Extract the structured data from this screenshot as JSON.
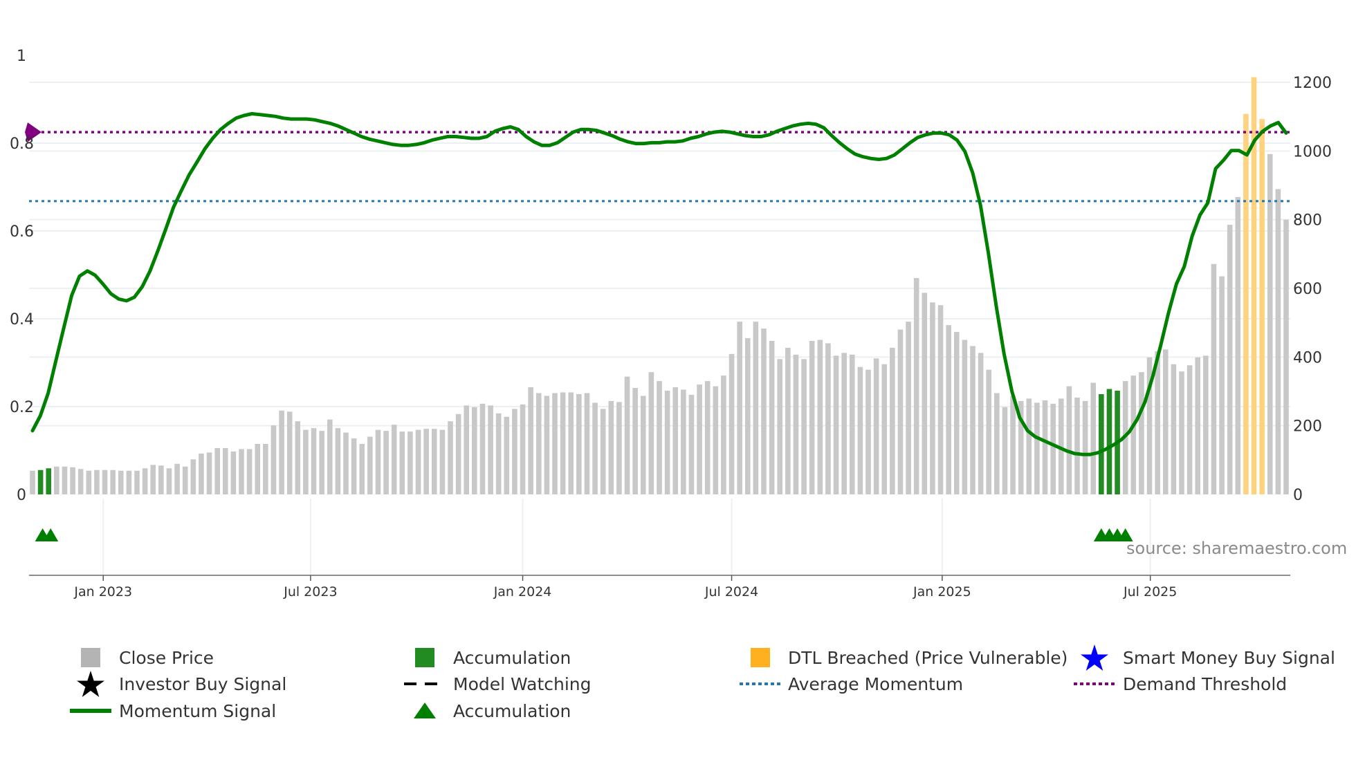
{
  "chart_data": {
    "type": "bar+line",
    "title": "",
    "x_unit": "week index",
    "x_ticks": [
      {
        "label": "Jan 2023",
        "pos": 8.8
      },
      {
        "label": "Jul 2023",
        "pos": 34.6
      },
      {
        "label": "Jan 2024",
        "pos": 61.0
      },
      {
        "label": "Jul 2024",
        "pos": 87.0
      },
      {
        "label": "Jan 2025",
        "pos": 113.2
      },
      {
        "label": "Jul 2025",
        "pos": 139.1
      }
    ],
    "left_axis": {
      "ylim": [
        0,
        1
      ],
      "ticks": [
        "0",
        "0.2",
        "0.4",
        "0.6",
        "0.8",
        "1"
      ],
      "tick_values": [
        0,
        0.2,
        0.4,
        0.6,
        0.8,
        1
      ]
    },
    "right_axis": {
      "ylim": [
        0,
        1200
      ],
      "ticks": [
        "0",
        "200",
        "400",
        "600",
        "800",
        "1000",
        "1200"
      ],
      "tick_values": [
        0,
        200,
        400,
        600,
        800,
        1000,
        1200
      ]
    },
    "close_price": [
      69,
      71,
      76,
      81,
      81,
      79,
      74,
      69,
      71,
      71,
      71,
      69,
      69,
      69,
      76,
      86,
      84,
      76,
      89,
      81,
      102,
      119,
      122,
      135,
      135,
      125,
      132,
      132,
      147,
      147,
      201,
      244,
      241,
      213,
      188,
      193,
      185,
      218,
      193,
      180,
      163,
      147,
      168,
      188,
      185,
      203,
      183,
      183,
      188,
      191,
      191,
      188,
      213,
      234,
      259,
      254,
      264,
      259,
      236,
      226,
      249,
      262,
      312,
      295,
      287,
      295,
      297,
      297,
      292,
      295,
      267,
      249,
      272,
      269,
      343,
      310,
      287,
      356,
      330,
      302,
      312,
      305,
      290,
      320,
      330,
      315,
      346,
      409,
      503,
      455,
      503,
      483,
      447,
      394,
      427,
      407,
      394,
      447,
      450,
      440,
      404,
      412,
      407,
      371,
      363,
      396,
      379,
      427,
      480,
      503,
      630,
      587,
      559,
      551,
      493,
      473,
      450,
      432,
      412,
      363,
      295,
      254,
      287,
      272,
      279,
      267,
      274,
      264,
      279,
      315,
      282,
      272,
      325,
      292,
      307,
      302,
      330,
      346,
      356,
      399,
      417,
      422,
      379,
      358,
      376,
      399,
      404,
      671,
      635,
      785,
      866,
      1108,
      1215,
      1093,
      991,
      889,
      800
    ],
    "accumulation_bars": [
      1,
      2,
      133,
      134,
      135
    ],
    "dtl_breached_bars": [
      151,
      152,
      153
    ],
    "momentum": [
      0.145,
      0.179,
      0.231,
      0.306,
      0.38,
      0.453,
      0.497,
      0.509,
      0.499,
      0.479,
      0.457,
      0.445,
      0.441,
      0.449,
      0.473,
      0.509,
      0.555,
      0.604,
      0.654,
      0.692,
      0.728,
      0.757,
      0.787,
      0.811,
      0.831,
      0.845,
      0.857,
      0.863,
      0.867,
      0.865,
      0.863,
      0.861,
      0.857,
      0.855,
      0.855,
      0.855,
      0.853,
      0.849,
      0.845,
      0.839,
      0.831,
      0.823,
      0.815,
      0.809,
      0.805,
      0.801,
      0.797,
      0.795,
      0.795,
      0.797,
      0.801,
      0.807,
      0.811,
      0.815,
      0.815,
      0.813,
      0.811,
      0.811,
      0.815,
      0.827,
      0.833,
      0.837,
      0.831,
      0.815,
      0.803,
      0.795,
      0.795,
      0.801,
      0.813,
      0.825,
      0.831,
      0.831,
      0.829,
      0.823,
      0.817,
      0.809,
      0.803,
      0.799,
      0.799,
      0.801,
      0.801,
      0.803,
      0.803,
      0.805,
      0.811,
      0.815,
      0.821,
      0.825,
      0.827,
      0.825,
      0.821,
      0.817,
      0.815,
      0.815,
      0.819,
      0.827,
      0.833,
      0.839,
      0.843,
      0.845,
      0.843,
      0.835,
      0.817,
      0.801,
      0.787,
      0.775,
      0.769,
      0.765,
      0.763,
      0.765,
      0.773,
      0.787,
      0.801,
      0.813,
      0.819,
      0.823,
      0.823,
      0.819,
      0.807,
      0.781,
      0.732,
      0.658,
      0.549,
      0.429,
      0.32,
      0.235,
      0.175,
      0.145,
      0.131,
      0.123,
      0.115,
      0.107,
      0.099,
      0.093,
      0.091,
      0.091,
      0.095,
      0.103,
      0.113,
      0.125,
      0.143,
      0.171,
      0.211,
      0.27,
      0.34,
      0.414,
      0.479,
      0.519,
      0.588,
      0.636,
      0.664,
      0.742,
      0.761,
      0.783,
      0.783,
      0.773,
      0.807,
      0.827,
      0.839,
      0.847,
      0.823
    ],
    "demand_threshold": 0.825,
    "average_momentum": 0.668,
    "accumulation_markers": [
      1,
      2,
      133,
      134,
      135,
      136
    ],
    "colors": {
      "close_price": "#c8c8c8",
      "accumulation": "#228b22",
      "dtl": "#ffb020",
      "momentum": "#008000",
      "avg_momentum": "#1f77b4",
      "demand": "#800080",
      "smart_money": "#0000ff"
    },
    "watermark": "source: sharemaestro.com",
    "legend": [
      {
        "label": "Close Price",
        "symbol": "square-gray"
      },
      {
        "label": "Accumulation",
        "symbol": "square-green"
      },
      {
        "label": "DTL Breached (Price Vulnerable)",
        "symbol": "square-orange"
      },
      {
        "label": "Smart Money Buy Signal",
        "symbol": "star-blue"
      },
      {
        "label": "Investor Buy Signal",
        "symbol": "star-black"
      },
      {
        "label": "Model Watching",
        "symbol": "dash-black"
      },
      {
        "label": "Average Momentum",
        "symbol": "dot-blue"
      },
      {
        "label": "Demand Threshold",
        "symbol": "dot-purple"
      },
      {
        "label": "Momentum Signal",
        "symbol": "line-green"
      },
      {
        "label": "Accumulation",
        "symbol": "triangle-green"
      }
    ],
    "legend_placement": "bottom"
  }
}
